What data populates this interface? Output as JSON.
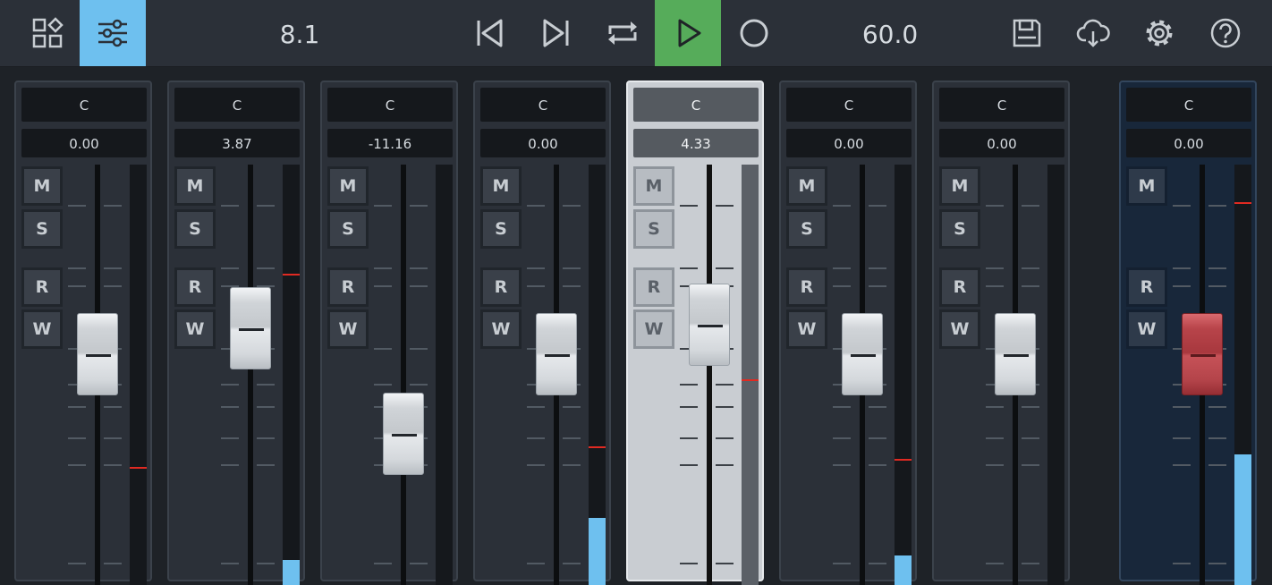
{
  "toolbar": {
    "position_readout": "8.1",
    "tempo_readout": "60.0",
    "icons": {
      "tiles": "tiles-icon",
      "mixer": "mixer-sliders-icon",
      "prev": "skip-back-icon",
      "next": "skip-forward-icon",
      "loop": "loop-icon",
      "play": "play-icon",
      "record": "record-icon",
      "save": "save-icon",
      "cloud": "cloud-download-icon",
      "settings": "gear-icon",
      "help": "help-icon"
    }
  },
  "colors": {
    "accent_blue": "#6ec0ef",
    "play_green": "#56ac5a",
    "peak_red": "#e02a22",
    "fx_fader_red": "#b8444a"
  },
  "channels": [
    {
      "pan": "C",
      "volume": "0.00",
      "level": 0.55,
      "meter": 0.0,
      "peak": 0.28,
      "buttons": [
        "M",
        "S",
        "R",
        "W"
      ]
    },
    {
      "pan": "C",
      "volume": "3.87",
      "level": 0.61,
      "meter": 0.06,
      "peak": 0.74,
      "buttons": [
        "M",
        "S",
        "R",
        "W"
      ]
    },
    {
      "pan": "C",
      "volume": "-11.16",
      "level": 0.36,
      "meter": 0.0,
      "peak": null,
      "buttons": [
        "M",
        "S",
        "R",
        "W"
      ]
    },
    {
      "pan": "C",
      "volume": "0.00",
      "level": 0.55,
      "meter": 0.16,
      "peak": 0.33,
      "buttons": [
        "M",
        "S",
        "R",
        "W"
      ]
    },
    {
      "pan": "C",
      "volume": "4.33",
      "level": 0.62,
      "meter": 0.0,
      "peak": 0.49,
      "buttons": [
        "M",
        "S",
        "R",
        "W"
      ],
      "selected": true
    },
    {
      "pan": "C",
      "volume": "0.00",
      "level": 0.55,
      "meter": 0.07,
      "peak": 0.3,
      "buttons": [
        "M",
        "S",
        "R",
        "W"
      ]
    },
    {
      "pan": "C",
      "volume": "0.00",
      "level": 0.55,
      "meter": 0.0,
      "peak": null,
      "buttons": [
        "M",
        "S",
        "R",
        "W"
      ]
    },
    {
      "pan": "C",
      "volume": "0.00",
      "level": 0.55,
      "meter": 0.31,
      "peak": 0.91,
      "buttons": [
        "M",
        "R",
        "W"
      ],
      "fx": true
    }
  ]
}
